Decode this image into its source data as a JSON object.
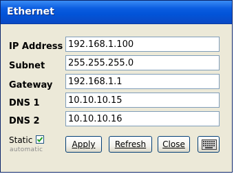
{
  "window": {
    "title": "Ethernet"
  },
  "fields": [
    {
      "label": "IP Address",
      "value": "192.168.1.100"
    },
    {
      "label": "Subnet",
      "value": "255.255.255.0"
    },
    {
      "label": "Gateway",
      "value": "192.168.1.1"
    },
    {
      "label": "DNS 1",
      "value": "10.10.10.15"
    },
    {
      "label": "DNS 2",
      "value": "10.10.10.16"
    }
  ],
  "static": {
    "label": "Static",
    "checked": true,
    "sublabel": "automatic"
  },
  "buttons": {
    "apply": "Apply",
    "refresh": "Refresh",
    "close": "Close"
  },
  "icons": {
    "keyboard": "keyboard-icon",
    "checkmark": "checkmark-icon"
  },
  "colors": {
    "titlebar": "#0254d8",
    "window_bg": "#ece9d8",
    "field_border": "#7f9db9"
  }
}
